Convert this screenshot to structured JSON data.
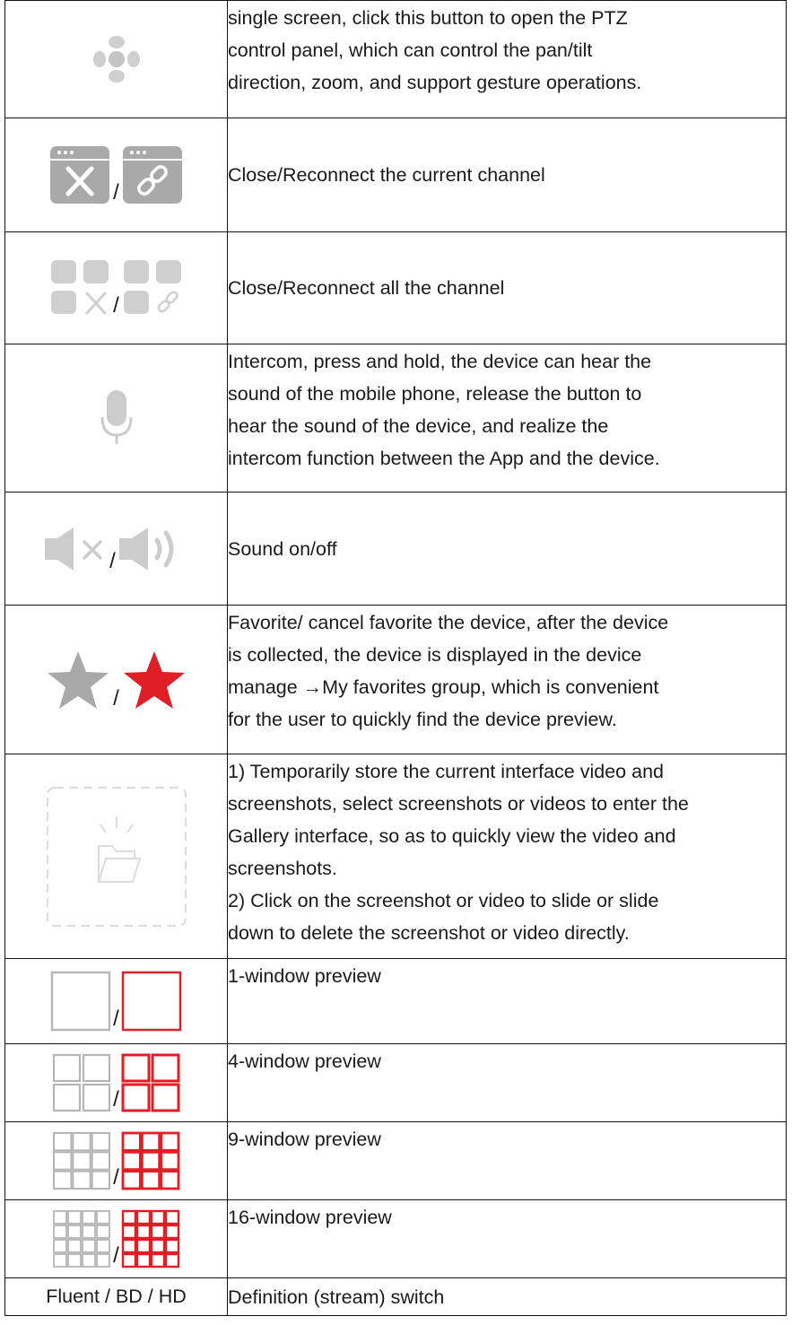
{
  "colors": {
    "icon_gray": "#b5b5b5",
    "icon_light": "#d4d4d4",
    "accent_red": "#e01e26",
    "border": "#111111"
  },
  "rows": [
    {
      "icon": "ptz-directional-pad-icon",
      "description": [
        "single screen, click this button to open the PTZ",
        "control panel, which can control the pan/tilt",
        "direction, zoom, and support gesture operations."
      ]
    },
    {
      "icon": "close-channel-icon / reconnect-channel-icon",
      "separator": "/",
      "description": [
        "Close/Reconnect the current channel"
      ]
    },
    {
      "icon": "close-all-channels-icon / reconnect-all-channels-icon",
      "separator": "/",
      "description": [
        "Close/Reconnect all the channel"
      ]
    },
    {
      "icon": "microphone-icon",
      "description": [
        "Intercom, press and hold, the device can hear the",
        "sound of the mobile phone, release the button to",
        "hear the sound of the device, and realize the",
        "intercom function between the App and the device."
      ]
    },
    {
      "icon": "sound-off-icon / sound-on-icon",
      "separator": "/",
      "description": [
        "Sound on/off"
      ]
    },
    {
      "icon": "favorite-gray-star-icon / favorite-red-star-icon",
      "separator": "/",
      "description": [
        "Favorite/ cancel favorite the device, after the device",
        "is collected, the device is displayed in the device",
        "manage →My favorites group, which is convenient",
        "for the user to quickly find the device preview."
      ]
    },
    {
      "icon": "gallery-folder-icon",
      "description": [
        "1) Temporarily store the current interface video and",
        "screenshots, select screenshots or videos to enter the",
        "Gallery interface, so as to quickly view the video and",
        "screenshots.",
        "2) Click on the screenshot or video to slide or slide",
        "down to delete the screenshot or video directly."
      ]
    },
    {
      "icon": "1-window-icon",
      "separator": "/",
      "description": [
        "1-window preview"
      ]
    },
    {
      "icon": "4-window-icon",
      "separator": "/",
      "description": [
        "4-window preview"
      ]
    },
    {
      "icon": "9-window-icon",
      "separator": "/",
      "description": [
        "9-window preview"
      ]
    },
    {
      "icon": "16-window-icon",
      "separator": "/",
      "description": [
        "16-window preview"
      ]
    },
    {
      "icon_text": "Fluent / BD / HD",
      "description": [
        "Definition (stream) switch"
      ]
    }
  ]
}
